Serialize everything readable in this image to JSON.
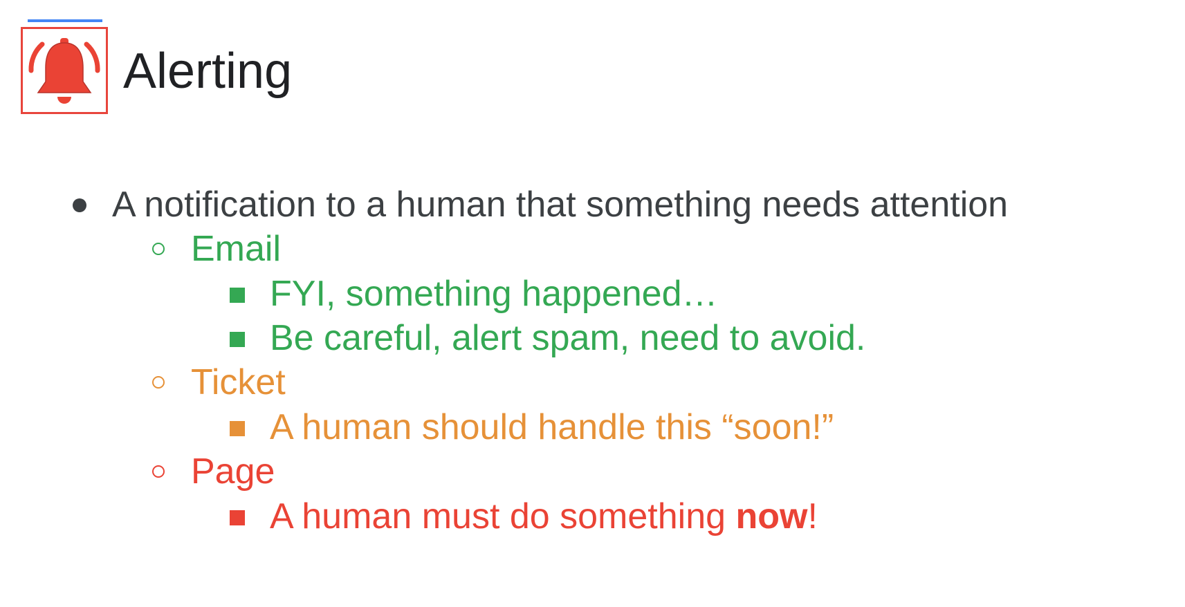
{
  "slide": {
    "title": "Alerting",
    "accent_color": "#4285f4",
    "icon": "bell-alert-icon",
    "bullets": {
      "main": "A notification to a human that something needs attention",
      "email": {
        "label": "Email",
        "color": "#34a853",
        "items": [
          "FYI, something happened…",
          "Be careful, alert spam, need to avoid."
        ]
      },
      "ticket": {
        "label": "Ticket",
        "color": "#e69138",
        "items": [
          "A human should handle this “soon!”"
        ]
      },
      "page": {
        "label": "Page",
        "color": "#ea4335",
        "item_prefix": "A human must do something ",
        "item_emphasis": "now",
        "item_suffix": "!"
      }
    }
  }
}
